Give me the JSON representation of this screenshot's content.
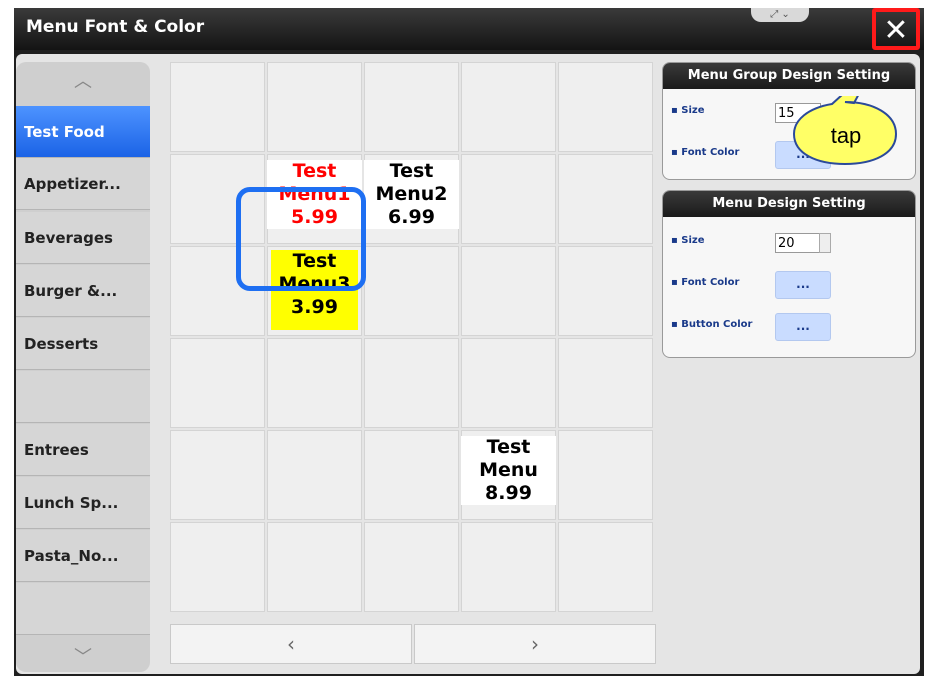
{
  "window": {
    "title": "Menu Font & Color",
    "close_glyph": "✕",
    "notch_glyph": "⤢ ⌄"
  },
  "categories": {
    "up_arrow": "︿",
    "down_arrow": "﹀",
    "items": [
      {
        "label": "Test Food",
        "active": true
      },
      {
        "label": "Appetizer...",
        "active": false
      },
      {
        "label": "Beverages",
        "active": false
      },
      {
        "label": "Burger &...",
        "active": false
      },
      {
        "label": "Desserts",
        "active": false
      },
      {
        "label": "",
        "active": false
      },
      {
        "label": "Entrees",
        "active": false
      },
      {
        "label": "Lunch Sp...",
        "active": false
      },
      {
        "label": "Pasta_No...",
        "active": false
      },
      {
        "label": "",
        "active": false
      }
    ]
  },
  "menu_items": [
    {
      "name1": "Test",
      "name2": "Menu1",
      "price": "5.99",
      "color": "#ff0000"
    },
    {
      "name1": "Test",
      "name2": "Menu2",
      "price": "6.99",
      "color": "#000000"
    },
    {
      "name1": "Test",
      "name2": "Menu3",
      "price": "3.99",
      "color": "#000000",
      "bg": "#ffff00"
    },
    {
      "name1": "Test",
      "name2": "Menu",
      "price": "8.99",
      "color": "#000000"
    }
  ],
  "pager": {
    "prev": "‹",
    "next": "›"
  },
  "group_design": {
    "title": "Menu Group Design Setting",
    "size_label": "Size",
    "size_value": "15",
    "font_color_label": "Font Color",
    "dots": "..."
  },
  "menu_design": {
    "title": "Menu Design Setting",
    "size_label": "Size",
    "size_value": "20",
    "font_color_label": "Font Color",
    "button_color_label": "Button Color",
    "dots": "..."
  },
  "callout": {
    "text": "tap"
  },
  "colors": {
    "accent_blue": "#1e6ff2",
    "highlight_red": "#ff1a1a",
    "callout_yellow": "#ffff66"
  }
}
